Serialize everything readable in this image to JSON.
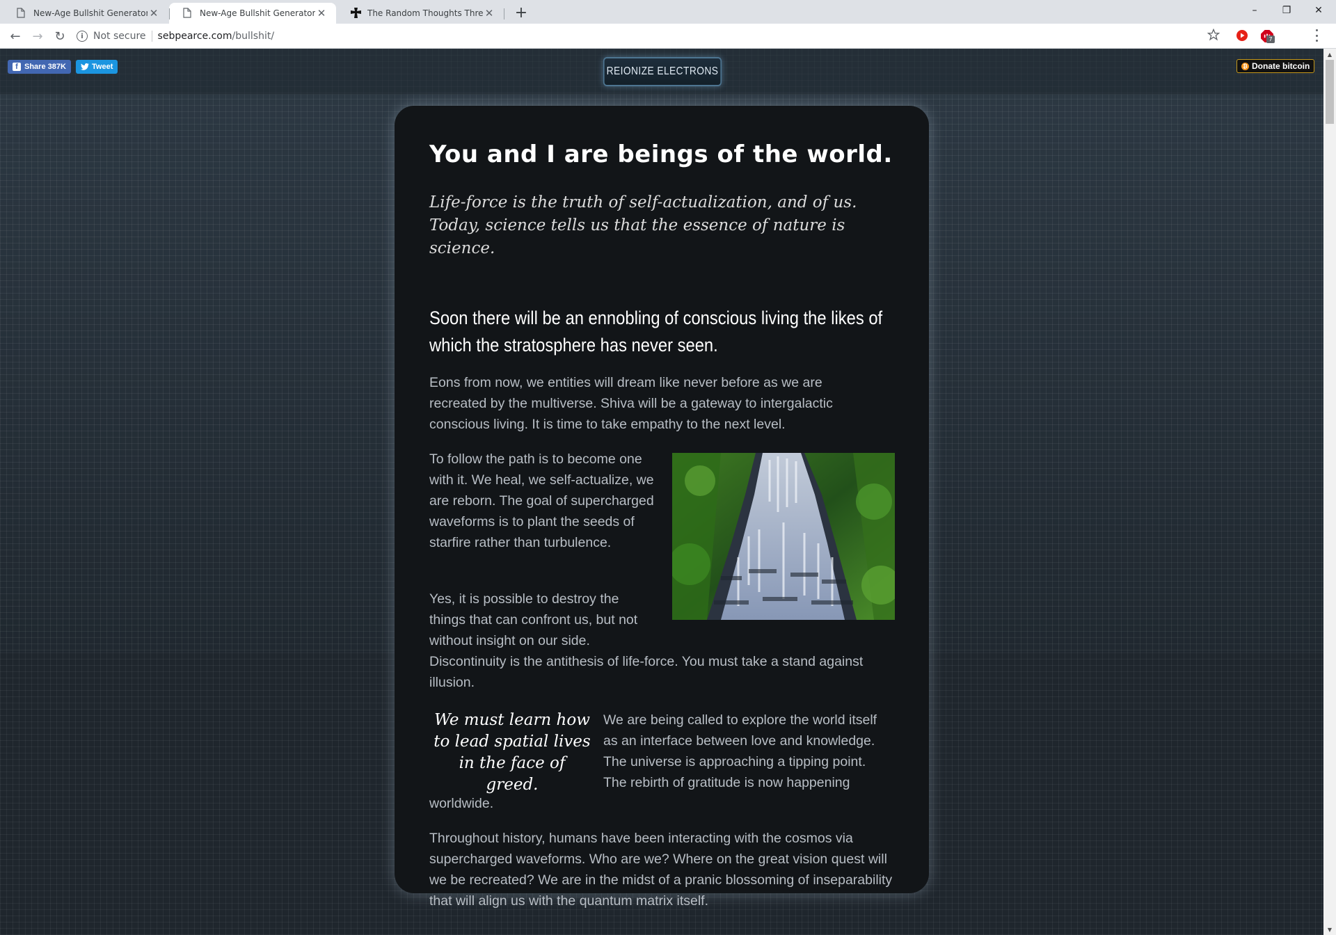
{
  "browser": {
    "tabs": [
      {
        "title": "New-Age Bullshit Generator",
        "active": false
      },
      {
        "title": "New-Age Bullshit Generator",
        "active": true
      },
      {
        "title": "The Random Thoughts Thread | F",
        "active": false
      }
    ],
    "new_tab_glyph": "+",
    "window_controls": {
      "minimize": "–",
      "restore": "❐",
      "close": "✕"
    },
    "nav": {
      "back": "←",
      "forward": "→",
      "reload": "↻"
    },
    "address": {
      "security_label": "Not secure",
      "host": "sebpearce.com",
      "path": "/bullshit/"
    },
    "extension_badge": "7"
  },
  "social": {
    "facebook": {
      "label": "Share 387K",
      "color": "#4267b2"
    },
    "twitter": {
      "label": "Tweet",
      "color": "#1b95e0"
    }
  },
  "reionize_button": "REIONIZE ELECTRONS",
  "donate_button": "Donate bitcoin",
  "article": {
    "heading": "You and I are beings of the world.",
    "lead": "Life-force is the truth of self-actualization, and of us. Today, science tells us that the essence of nature is science.",
    "subheading": "Soon there will be an ennobling of conscious living the likes of which the stratosphere has never seen.",
    "paragraphs": [
      "Eons from now, we entities will dream like never before as we are recreated by the multiverse. Shiva will be a gateway to intergalactic conscious living. It is time to take empathy to the next level.",
      "To follow the path is to become one with it. We heal, we self-actualize, we are reborn. The goal of supercharged waveforms is to plant the seeds of starfire rather than turbulence.",
      "Yes, it is possible to destroy the things that can confront us, but not without insight on our side.",
      "Discontinuity is the antithesis of life-force. You must take a stand against illusion.",
      "We are being called to explore the world itself as an interface between love and knowledge. The universe is approaching a tipping point. The rebirth of gratitude is now happening",
      "worldwide.",
      "Throughout history, humans have been interacting with the cosmos via supercharged waveforms. Who are we? Where on the great vision quest will we be recreated? We are in the midst of a pranic blossoming of inseparability that will align us with the quantum matrix itself."
    ],
    "pullquote": "We must learn how to lead spatial lives in the face of greed."
  },
  "colors": {
    "card_bg": "#121518",
    "accent_glow": "#4d7591",
    "bitcoin": "#f7931a"
  }
}
